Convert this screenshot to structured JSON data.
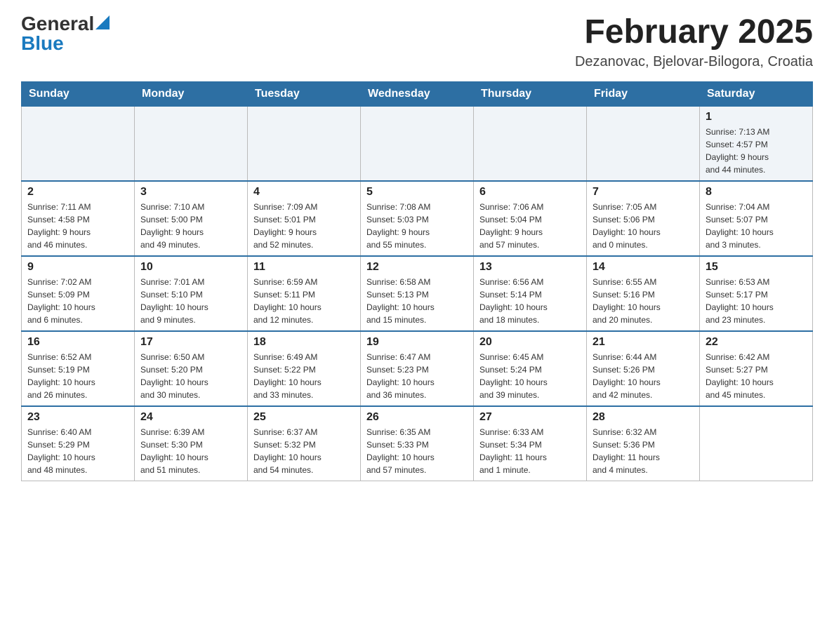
{
  "header": {
    "logo_general": "General",
    "logo_blue": "Blue",
    "month_title": "February 2025",
    "subtitle": "Dezanovac, Bjelovar-Bilogora, Croatia"
  },
  "days_of_week": [
    "Sunday",
    "Monday",
    "Tuesday",
    "Wednesday",
    "Thursday",
    "Friday",
    "Saturday"
  ],
  "weeks": [
    {
      "days": [
        {
          "number": "",
          "info": ""
        },
        {
          "number": "",
          "info": ""
        },
        {
          "number": "",
          "info": ""
        },
        {
          "number": "",
          "info": ""
        },
        {
          "number": "",
          "info": ""
        },
        {
          "number": "",
          "info": ""
        },
        {
          "number": "1",
          "info": "Sunrise: 7:13 AM\nSunset: 4:57 PM\nDaylight: 9 hours\nand 44 minutes."
        }
      ]
    },
    {
      "days": [
        {
          "number": "2",
          "info": "Sunrise: 7:11 AM\nSunset: 4:58 PM\nDaylight: 9 hours\nand 46 minutes."
        },
        {
          "number": "3",
          "info": "Sunrise: 7:10 AM\nSunset: 5:00 PM\nDaylight: 9 hours\nand 49 minutes."
        },
        {
          "number": "4",
          "info": "Sunrise: 7:09 AM\nSunset: 5:01 PM\nDaylight: 9 hours\nand 52 minutes."
        },
        {
          "number": "5",
          "info": "Sunrise: 7:08 AM\nSunset: 5:03 PM\nDaylight: 9 hours\nand 55 minutes."
        },
        {
          "number": "6",
          "info": "Sunrise: 7:06 AM\nSunset: 5:04 PM\nDaylight: 9 hours\nand 57 minutes."
        },
        {
          "number": "7",
          "info": "Sunrise: 7:05 AM\nSunset: 5:06 PM\nDaylight: 10 hours\nand 0 minutes."
        },
        {
          "number": "8",
          "info": "Sunrise: 7:04 AM\nSunset: 5:07 PM\nDaylight: 10 hours\nand 3 minutes."
        }
      ]
    },
    {
      "days": [
        {
          "number": "9",
          "info": "Sunrise: 7:02 AM\nSunset: 5:09 PM\nDaylight: 10 hours\nand 6 minutes."
        },
        {
          "number": "10",
          "info": "Sunrise: 7:01 AM\nSunset: 5:10 PM\nDaylight: 10 hours\nand 9 minutes."
        },
        {
          "number": "11",
          "info": "Sunrise: 6:59 AM\nSunset: 5:11 PM\nDaylight: 10 hours\nand 12 minutes."
        },
        {
          "number": "12",
          "info": "Sunrise: 6:58 AM\nSunset: 5:13 PM\nDaylight: 10 hours\nand 15 minutes."
        },
        {
          "number": "13",
          "info": "Sunrise: 6:56 AM\nSunset: 5:14 PM\nDaylight: 10 hours\nand 18 minutes."
        },
        {
          "number": "14",
          "info": "Sunrise: 6:55 AM\nSunset: 5:16 PM\nDaylight: 10 hours\nand 20 minutes."
        },
        {
          "number": "15",
          "info": "Sunrise: 6:53 AM\nSunset: 5:17 PM\nDaylight: 10 hours\nand 23 minutes."
        }
      ]
    },
    {
      "days": [
        {
          "number": "16",
          "info": "Sunrise: 6:52 AM\nSunset: 5:19 PM\nDaylight: 10 hours\nand 26 minutes."
        },
        {
          "number": "17",
          "info": "Sunrise: 6:50 AM\nSunset: 5:20 PM\nDaylight: 10 hours\nand 30 minutes."
        },
        {
          "number": "18",
          "info": "Sunrise: 6:49 AM\nSunset: 5:22 PM\nDaylight: 10 hours\nand 33 minutes."
        },
        {
          "number": "19",
          "info": "Sunrise: 6:47 AM\nSunset: 5:23 PM\nDaylight: 10 hours\nand 36 minutes."
        },
        {
          "number": "20",
          "info": "Sunrise: 6:45 AM\nSunset: 5:24 PM\nDaylight: 10 hours\nand 39 minutes."
        },
        {
          "number": "21",
          "info": "Sunrise: 6:44 AM\nSunset: 5:26 PM\nDaylight: 10 hours\nand 42 minutes."
        },
        {
          "number": "22",
          "info": "Sunrise: 6:42 AM\nSunset: 5:27 PM\nDaylight: 10 hours\nand 45 minutes."
        }
      ]
    },
    {
      "days": [
        {
          "number": "23",
          "info": "Sunrise: 6:40 AM\nSunset: 5:29 PM\nDaylight: 10 hours\nand 48 minutes."
        },
        {
          "number": "24",
          "info": "Sunrise: 6:39 AM\nSunset: 5:30 PM\nDaylight: 10 hours\nand 51 minutes."
        },
        {
          "number": "25",
          "info": "Sunrise: 6:37 AM\nSunset: 5:32 PM\nDaylight: 10 hours\nand 54 minutes."
        },
        {
          "number": "26",
          "info": "Sunrise: 6:35 AM\nSunset: 5:33 PM\nDaylight: 10 hours\nand 57 minutes."
        },
        {
          "number": "27",
          "info": "Sunrise: 6:33 AM\nSunset: 5:34 PM\nDaylight: 11 hours\nand 1 minute."
        },
        {
          "number": "28",
          "info": "Sunrise: 6:32 AM\nSunset: 5:36 PM\nDaylight: 11 hours\nand 4 minutes."
        },
        {
          "number": "",
          "info": ""
        }
      ]
    }
  ]
}
